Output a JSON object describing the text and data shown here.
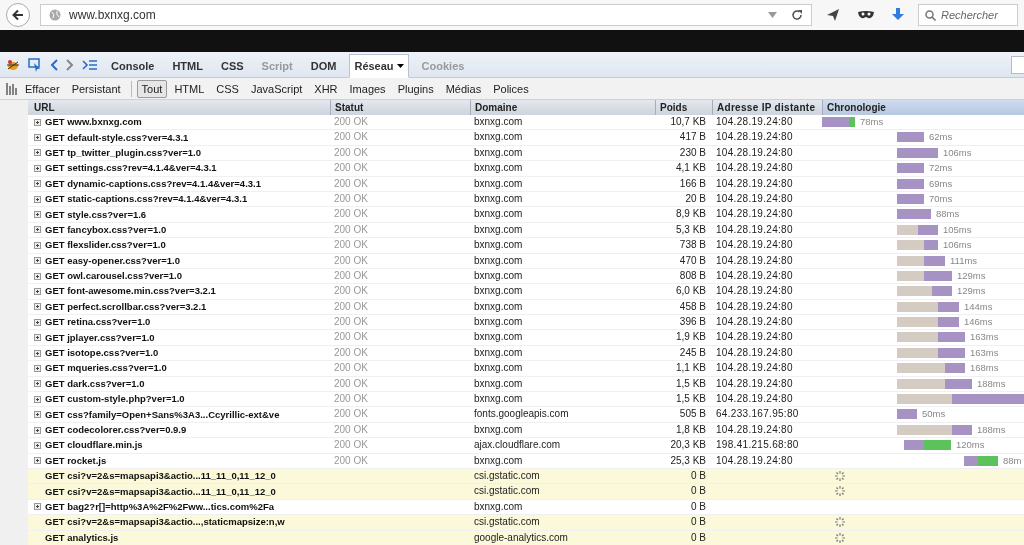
{
  "browser": {
    "url": "www.bxnxg.com",
    "search_placeholder": "Rechercher"
  },
  "firebug": {
    "tabs": [
      {
        "label": "Console",
        "selected": false,
        "disabled": false
      },
      {
        "label": "HTML",
        "selected": false,
        "disabled": false
      },
      {
        "label": "CSS",
        "selected": false,
        "disabled": false
      },
      {
        "label": "Script",
        "selected": false,
        "disabled": true
      },
      {
        "label": "DOM",
        "selected": false,
        "disabled": false
      },
      {
        "label": "Réseau",
        "selected": true,
        "disabled": false
      },
      {
        "label": "Cookies",
        "selected": false,
        "disabled": true
      }
    ],
    "actions": [
      "Effacer",
      "Persistant"
    ],
    "filters": [
      {
        "label": "Tout",
        "selected": true
      },
      {
        "label": "HTML",
        "selected": false
      },
      {
        "label": "CSS",
        "selected": false
      },
      {
        "label": "JavaScript",
        "selected": false
      },
      {
        "label": "XHR",
        "selected": false
      },
      {
        "label": "Images",
        "selected": false
      },
      {
        "label": "Plugins",
        "selected": false
      },
      {
        "label": "Médias",
        "selected": false
      },
      {
        "label": "Polices",
        "selected": false
      }
    ]
  },
  "table": {
    "columns": [
      "URL",
      "Statut",
      "Domaine",
      "Poids",
      "Adresse IP distante",
      "Chronologie"
    ],
    "rows": [
      {
        "url": "GET www.bxnxg.com",
        "status": "200 OK",
        "domain": "bxnxg.com",
        "size": "10,7 KB",
        "ip": "104.28.19.24:80",
        "time": "78ms",
        "expandable": true,
        "pending": false
      },
      {
        "url": "GET default-style.css?ver=4.3.1",
        "status": "200 OK",
        "domain": "bxnxg.com",
        "size": "417 B",
        "ip": "104.28.19.24:80",
        "time": "62ms",
        "expandable": true,
        "pending": false
      },
      {
        "url": "GET tp_twitter_plugin.css?ver=1.0",
        "status": "200 OK",
        "domain": "bxnxg.com",
        "size": "230 B",
        "ip": "104.28.19.24:80",
        "time": "106ms",
        "expandable": true,
        "pending": false
      },
      {
        "url": "GET settings.css?rev=4.1.4&ver=4.3.1",
        "status": "200 OK",
        "domain": "bxnxg.com",
        "size": "4,1 KB",
        "ip": "104.28.19.24:80",
        "time": "72ms",
        "expandable": true,
        "pending": false
      },
      {
        "url": "GET dynamic-captions.css?rev=4.1.4&ver=4.3.1",
        "status": "200 OK",
        "domain": "bxnxg.com",
        "size": "166 B",
        "ip": "104.28.19.24:80",
        "time": "69ms",
        "expandable": true,
        "pending": false
      },
      {
        "url": "GET static-captions.css?rev=4.1.4&ver=4.3.1",
        "status": "200 OK",
        "domain": "bxnxg.com",
        "size": "20 B",
        "ip": "104.28.19.24:80",
        "time": "70ms",
        "expandable": true,
        "pending": false
      },
      {
        "url": "GET style.css?ver=1.6",
        "status": "200 OK",
        "domain": "bxnxg.com",
        "size": "8,9 KB",
        "ip": "104.28.19.24:80",
        "time": "88ms",
        "expandable": true,
        "pending": false
      },
      {
        "url": "GET fancybox.css?ver=1.0",
        "status": "200 OK",
        "domain": "bxnxg.com",
        "size": "5,3 KB",
        "ip": "104.28.19.24:80",
        "time": "105ms",
        "expandable": true,
        "pending": false
      },
      {
        "url": "GET flexslider.css?ver=1.0",
        "status": "200 OK",
        "domain": "bxnxg.com",
        "size": "738 B",
        "ip": "104.28.19.24:80",
        "time": "106ms",
        "expandable": true,
        "pending": false
      },
      {
        "url": "GET easy-opener.css?ver=1.0",
        "status": "200 OK",
        "domain": "bxnxg.com",
        "size": "470 B",
        "ip": "104.28.19.24:80",
        "time": "111ms",
        "expandable": true,
        "pending": false
      },
      {
        "url": "GET owl.carousel.css?ver=1.0",
        "status": "200 OK",
        "domain": "bxnxg.com",
        "size": "808 B",
        "ip": "104.28.19.24:80",
        "time": "129ms",
        "expandable": true,
        "pending": false
      },
      {
        "url": "GET font-awesome.min.css?ver=3.2.1",
        "status": "200 OK",
        "domain": "bxnxg.com",
        "size": "6,0 KB",
        "ip": "104.28.19.24:80",
        "time": "129ms",
        "expandable": true,
        "pending": false
      },
      {
        "url": "GET perfect.scrollbar.css?ver=3.2.1",
        "status": "200 OK",
        "domain": "bxnxg.com",
        "size": "458 B",
        "ip": "104.28.19.24:80",
        "time": "144ms",
        "expandable": true,
        "pending": false
      },
      {
        "url": "GET retina.css?ver=1.0",
        "status": "200 OK",
        "domain": "bxnxg.com",
        "size": "396 B",
        "ip": "104.28.19.24:80",
        "time": "146ms",
        "expandable": true,
        "pending": false
      },
      {
        "url": "GET jplayer.css?ver=1.0",
        "status": "200 OK",
        "domain": "bxnxg.com",
        "size": "1,9 KB",
        "ip": "104.28.19.24:80",
        "time": "163ms",
        "expandable": true,
        "pending": false
      },
      {
        "url": "GET isotope.css?ver=1.0",
        "status": "200 OK",
        "domain": "bxnxg.com",
        "size": "245 B",
        "ip": "104.28.19.24:80",
        "time": "163ms",
        "expandable": true,
        "pending": false
      },
      {
        "url": "GET mqueries.css?ver=1.0",
        "status": "200 OK",
        "domain": "bxnxg.com",
        "size": "1,1 KB",
        "ip": "104.28.19.24:80",
        "time": "168ms",
        "expandable": true,
        "pending": false
      },
      {
        "url": "GET dark.css?ver=1.0",
        "status": "200 OK",
        "domain": "bxnxg.com",
        "size": "1,5 KB",
        "ip": "104.28.19.24:80",
        "time": "188ms",
        "expandable": true,
        "pending": false
      },
      {
        "url": "GET custom-style.php?ver=1.0",
        "status": "200 OK",
        "domain": "bxnxg.com",
        "size": "1,5 KB",
        "ip": "104.28.19.24:80",
        "expandable": true,
        "pending": false
      },
      {
        "url": "GET css?family=Open+Sans%3A3...Ccyrillic-ext&ve",
        "status": "200 OK",
        "domain": "fonts.googleapis.com",
        "size": "505 B",
        "ip": "64.233.167.95:80",
        "time": "50ms",
        "expandable": true,
        "pending": false
      },
      {
        "url": "GET codecolorer.css?ver=0.9.9",
        "status": "200 OK",
        "domain": "bxnxg.com",
        "size": "1,8 KB",
        "ip": "104.28.19.24:80",
        "time": "188ms",
        "expandable": true,
        "pending": false
      },
      {
        "url": "GET cloudflare.min.js",
        "status": "200 OK",
        "domain": "ajax.cloudflare.com",
        "size": "20,3 KB",
        "ip": "198.41.215.68:80",
        "time": "120ms",
        "expandable": true,
        "pending": false
      },
      {
        "url": "GET rocket.js",
        "status": "200 OK",
        "domain": "bxnxg.com",
        "size": "25,3 KB",
        "ip": "104.28.19.24:80",
        "time": "88m",
        "expandable": true,
        "pending": false
      },
      {
        "url": "GET csi?v=2&s=mapsapi3&actio...11_11_0,11_12_0",
        "domain": "csi.gstatic.com",
        "size": "0 B",
        "expandable": false,
        "pending": true
      },
      {
        "url": "GET csi?v=2&s=mapsapi3&actio...11_11_0,11_12_0",
        "domain": "csi.gstatic.com",
        "size": "0 B",
        "expandable": false,
        "pending": true
      },
      {
        "url": "GET bag2?r[]=http%3A%2F%2Fww...tics.com%2Fa",
        "domain": "bxnxg.com",
        "size": "0 B",
        "expandable": true,
        "pending": false
      },
      {
        "url": "GET csi?v=2&s=mapsapi3&actio...,staticmapsize:n,w",
        "domain": "csi.gstatic.com",
        "size": "0 B",
        "expandable": false,
        "pending": true
      },
      {
        "url": "GET analytics.js",
        "domain": "google-analytics.com",
        "size": "0 B",
        "expandable": false,
        "pending": true
      }
    ]
  }
}
